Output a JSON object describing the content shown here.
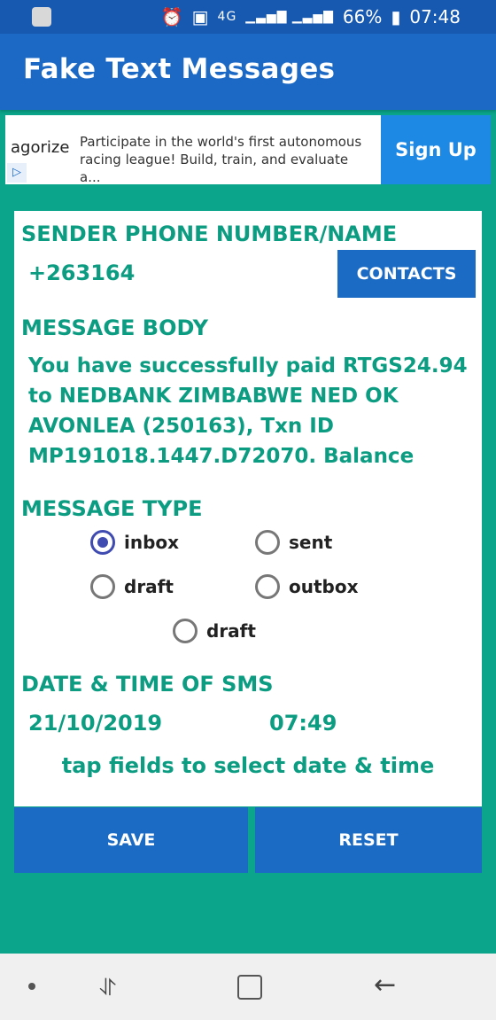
{
  "status": {
    "network": "4G",
    "battery": "66%",
    "time": "07:48"
  },
  "app": {
    "title": "Fake Text Messages"
  },
  "ad": {
    "brand": "agorize",
    "text": "Participate in the world's first autonomous racing league! Build, train, and evaluate a...",
    "cta": "Sign Up"
  },
  "form": {
    "sender_label": "SENDER PHONE NUMBER/NAME",
    "sender_value": "+263164",
    "contacts_button": "CONTACTS",
    "body_label": "MESSAGE BODY",
    "body_value": "You have successfully paid RTGS24.94 to NEDBANK ZIMBABWE NED OK AVONLEA (250163), Txn ID MP191018.1447.D72070. Balance",
    "type_label": "MESSAGE TYPE",
    "types": [
      {
        "label": "inbox",
        "checked": true
      },
      {
        "label": "sent",
        "checked": false
      },
      {
        "label": "draft",
        "checked": false
      },
      {
        "label": "outbox",
        "checked": false
      },
      {
        "label": "draft",
        "checked": false
      }
    ],
    "datetime_label": "DATE & TIME OF SMS",
    "date": "21/10/2019",
    "time": "07:49",
    "hint": "tap fields to select date & time",
    "save": "SAVE",
    "reset": "RESET"
  }
}
